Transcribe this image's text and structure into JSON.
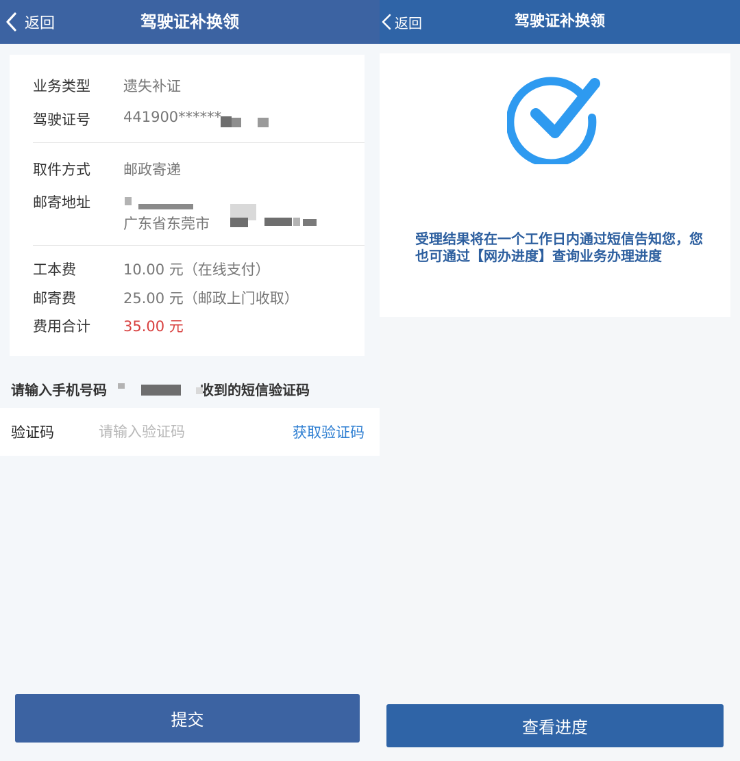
{
  "left": {
    "nav": {
      "back_label": "返回",
      "title": "驾驶证补换领"
    },
    "rows": {
      "business_type": {
        "label": "业务类型",
        "value": "遗失补证"
      },
      "license_no": {
        "label": "驾驶证号",
        "value": "441900******"
      },
      "pickup": {
        "label": "取件方式",
        "value": "邮政寄递"
      },
      "address": {
        "label": "邮寄地址",
        "value": "广东省东莞市"
      },
      "work_fee": {
        "label": "工本费",
        "value": "10.00 元（在线支付）"
      },
      "postage": {
        "label": "邮寄费",
        "value": "25.00 元（邮政上门收取）"
      },
      "total": {
        "label": "费用合计",
        "value": "35.00 元"
      }
    },
    "sms_hint_prefix": "请输入手机号码",
    "sms_hint_suffix": "收到的短信验证码",
    "code": {
      "label": "验证码",
      "placeholder": "请输入验证码",
      "get_code": "获取验证码"
    },
    "submit_label": "提交"
  },
  "right": {
    "nav": {
      "back_label": "返回",
      "title": "驾驶证补换领"
    },
    "icon": "check-circle-icon",
    "result_text": "受理结果将在一个工作日内通过短信告知您，您也可通过【网办进度】查询业务办理进度",
    "progress_button": "查看进度"
  },
  "colors": {
    "nav_left": "#3c63a2",
    "nav_right": "#2f64a7",
    "accent_blue": "#2f7fd2",
    "total_red": "#d8403f",
    "check_blue": "#2e9af0"
  }
}
